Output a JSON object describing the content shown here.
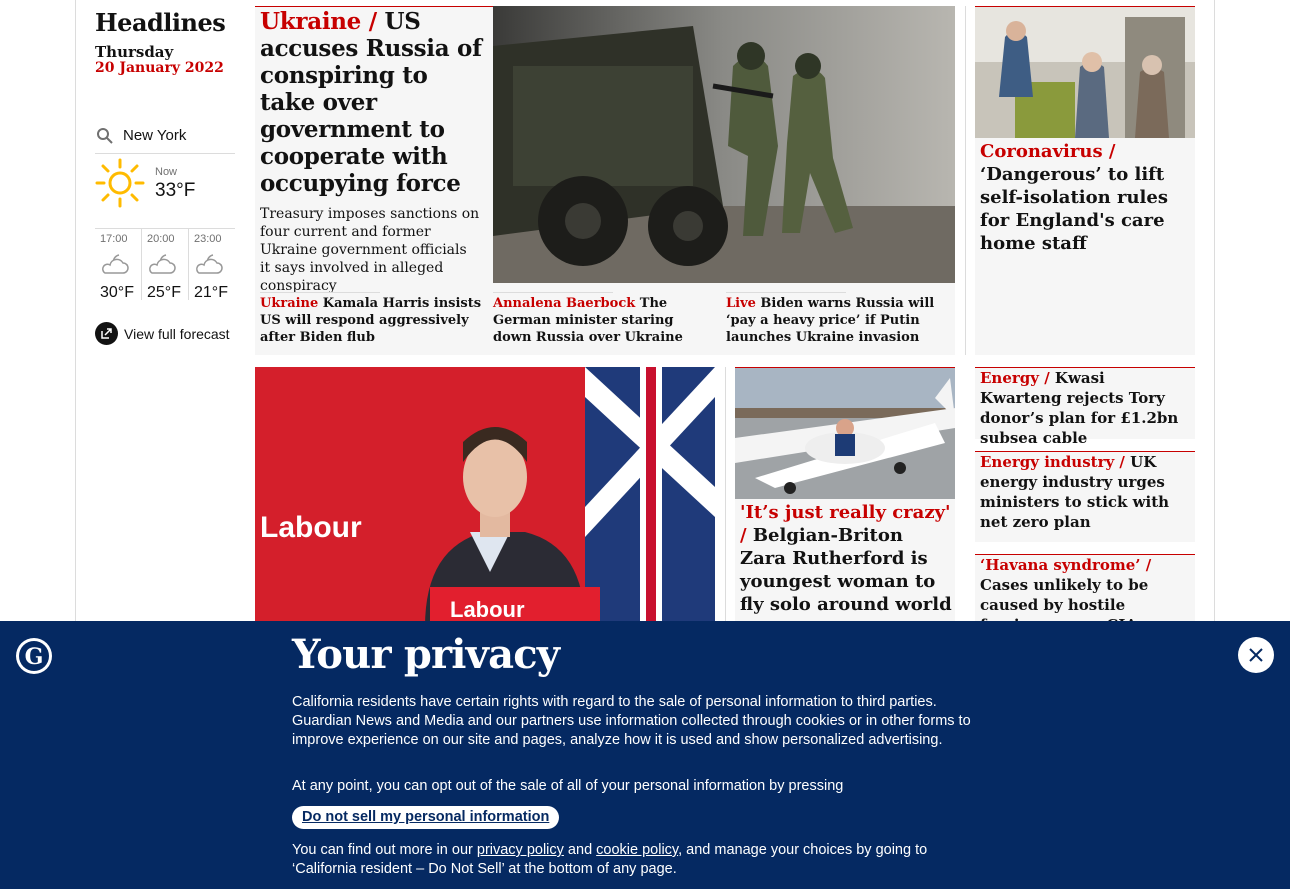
{
  "sidebar": {
    "title": "Headlines",
    "day": "Thursday",
    "date": "20 January 2022",
    "weather": {
      "location": "New York",
      "now_label": "Now",
      "now_temp": "33°F",
      "forecast": [
        {
          "time": "17:00",
          "temp": "30°F"
        },
        {
          "time": "20:00",
          "temp": "25°F"
        },
        {
          "time": "23:00",
          "temp": "21°F"
        }
      ],
      "full_forecast_label": "View full forecast"
    }
  },
  "main_story": {
    "kicker": "Ukraine /",
    "headline": " US accuses Russia of conspiring to take over government to cooperate with occupying force",
    "standfirst": "Treasury imposes sanctions on four current and former Ukraine government officials it says involved in alleged conspiracy",
    "sublinks": [
      {
        "kicker": "Ukraine",
        "text": " Kamala Harris insists US will respond aggressively after Biden flub"
      },
      {
        "kicker": "Annalena Baerbock",
        "text": " The German minister staring down Russia over Ukraine"
      },
      {
        "kicker": "Live",
        "text": " Biden warns Russia will ‘pay a heavy price’ if Putin launches Ukraine invasion"
      }
    ]
  },
  "right_story": {
    "kicker": "Coronavirus /",
    "headline": " ‘Dangerous’ to lift self-isolation rules for England's care home staff"
  },
  "zara_story": {
    "kicker": "'It’s just really crazy' /",
    "headline": " Belgian-Briton Zara Rutherford is youngest woman to fly solo around world"
  },
  "small_stories": [
    {
      "kicker": "Energy /",
      "headline": " Kwasi Kwarteng rejects Tory donor’s plan for £1.2bn subsea cable"
    },
    {
      "kicker": "Energy industry /",
      "headline": " UK energy industry urges ministers to stick with net zero plan"
    },
    {
      "kicker": "‘Havana syndrome’ /",
      "headline": " Cases unlikely to be caused by hostile foreign power, CIA"
    }
  ],
  "images": {
    "labour_sign": "Labour"
  },
  "privacy": {
    "title": "Your privacy",
    "body": "California residents have certain rights with regard to the sale of personal information to third parties. Guardian News and Media and our partners use information collected through cookies or in other forms to improve experience on our site and pages, analyze how it is used and show personalized advertising.",
    "opt_out_text": "At any point, you can opt out of the sale of all of your personal information by pressing",
    "button_label": "Do not sell my personal information",
    "find_more_prefix": "You can find out more in our ",
    "privacy_link": "privacy policy",
    "and_text": " and ",
    "cookie_link": "cookie policy",
    "find_more_suffix": ", and manage your choices by going to ‘California resident – Do Not Sell’ at the bottom of any page."
  },
  "colors": {
    "accent_red": "#c70000",
    "banner_blue": "#052962",
    "card_grey": "#f6f6f6"
  }
}
